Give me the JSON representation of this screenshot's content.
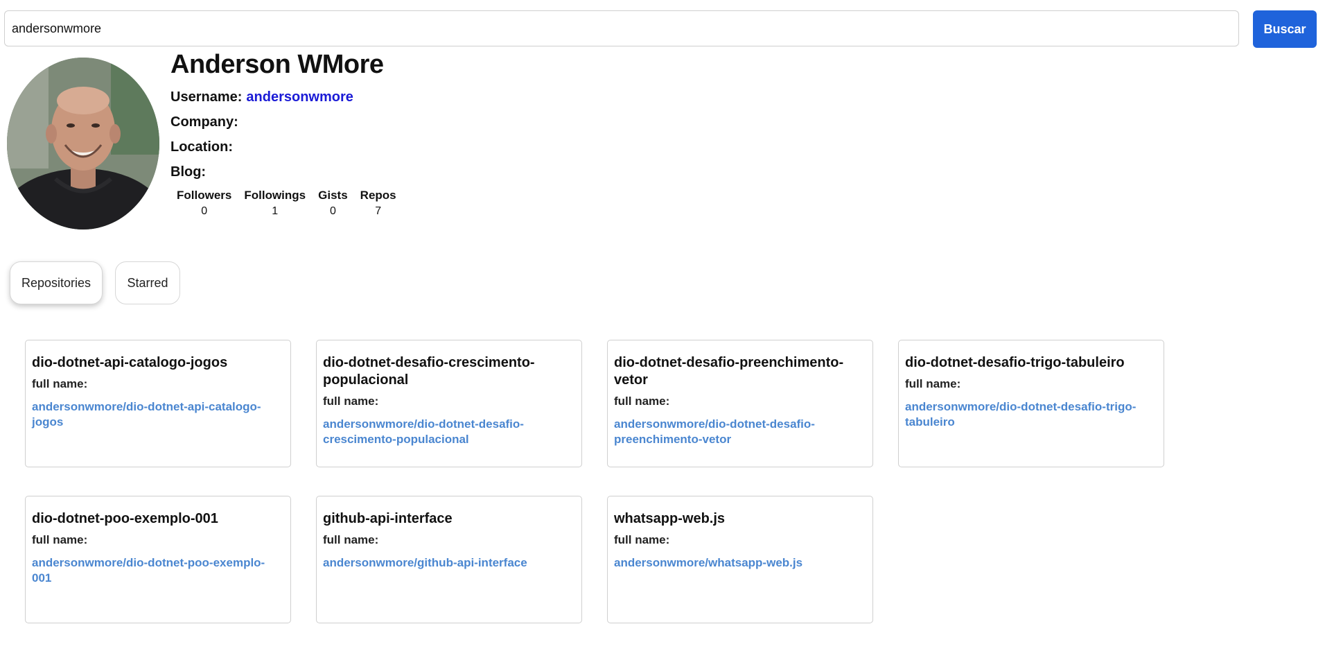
{
  "search": {
    "value": "andersonwmore",
    "button_label": "Buscar"
  },
  "profile": {
    "name": "Anderson WMore",
    "username_label": "Username:",
    "username": "andersonwmore",
    "company_label": "Company:",
    "location_label": "Location:",
    "blog_label": "Blog:",
    "stats": [
      {
        "label": "Followers",
        "value": "0"
      },
      {
        "label": "Followings",
        "value": "1"
      },
      {
        "label": "Gists",
        "value": "0"
      },
      {
        "label": "Repos",
        "value": "7"
      }
    ]
  },
  "tabs": [
    {
      "label": "Repositories",
      "active": true
    },
    {
      "label": "Starred",
      "active": false
    }
  ],
  "repos": [
    {
      "name": "dio-dotnet-api-catalogo-jogos",
      "full_name_label": "full name:",
      "full_name": "andersonwmore/dio-dotnet-api-catalogo-jogos"
    },
    {
      "name": "dio-dotnet-desafio-crescimento-populacional",
      "full_name_label": "full name:",
      "full_name": "andersonwmore/dio-dotnet-desafio-crescimento-populacional"
    },
    {
      "name": "dio-dotnet-desafio-preenchimento-vetor",
      "full_name_label": "full name:",
      "full_name": "andersonwmore/dio-dotnet-desafio-preenchimento-vetor"
    },
    {
      "name": "dio-dotnet-desafio-trigo-tabuleiro",
      "full_name_label": "full name:",
      "full_name": "andersonwmore/dio-dotnet-desafio-trigo-tabuleiro"
    },
    {
      "name": "dio-dotnet-poo-exemplo-001",
      "full_name_label": "full name:",
      "full_name": "andersonwmore/dio-dotnet-poo-exemplo-001"
    },
    {
      "name": "github-api-interface",
      "full_name_label": "full name:",
      "full_name": "andersonwmore/github-api-interface"
    },
    {
      "name": "whatsapp-web.js",
      "full_name_label": "full name:",
      "full_name": "andersonwmore/whatsapp-web.js"
    }
  ],
  "colors": {
    "accent": "#1f63db",
    "username_link": "#1a1ad6",
    "repo_link": "#4a86d0"
  }
}
